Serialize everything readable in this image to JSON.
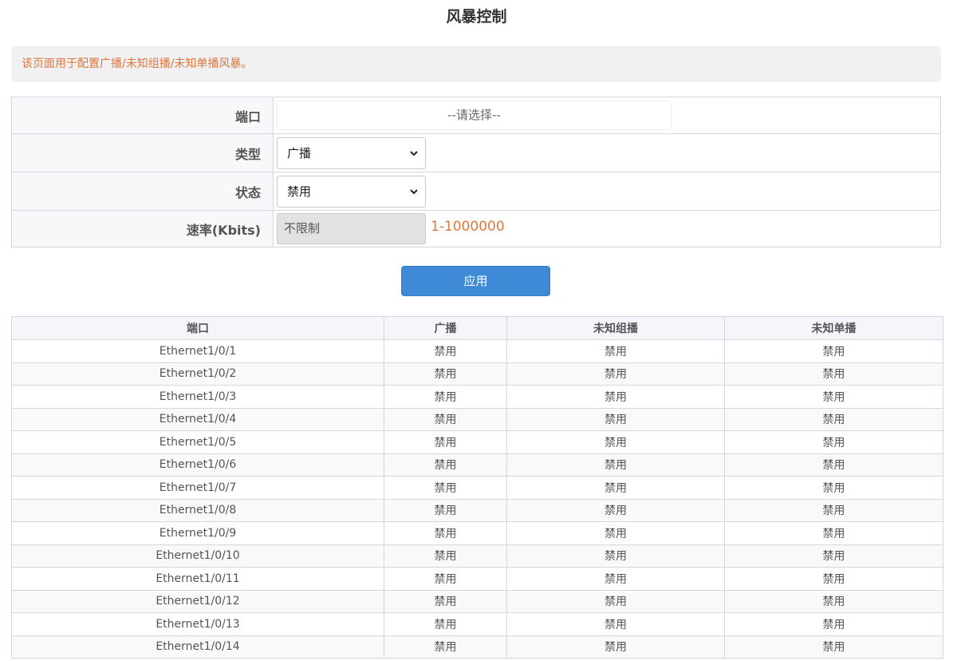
{
  "page": {
    "title": "风暴控制",
    "notice": "该页面用于配置广播/未知组播/未知单播风暴。"
  },
  "form": {
    "port_label": "端口",
    "port_placeholder": "--请选择--",
    "type_label": "类型",
    "type_value": "广播",
    "status_label": "状态",
    "status_value": "禁用",
    "rate_label": "速率(Kbits)",
    "rate_value": "不限制",
    "rate_range": "1-1000000",
    "apply_label": "应用"
  },
  "table": {
    "headers": {
      "port": "端口",
      "broadcast": "广播",
      "unknown_multicast": "未知组播",
      "unknown_unicast": "未知单播"
    },
    "rows": [
      {
        "port": "Ethernet1/0/1",
        "broadcast": "禁用",
        "unknown_multicast": "禁用",
        "unknown_unicast": "禁用"
      },
      {
        "port": "Ethernet1/0/2",
        "broadcast": "禁用",
        "unknown_multicast": "禁用",
        "unknown_unicast": "禁用"
      },
      {
        "port": "Ethernet1/0/3",
        "broadcast": "禁用",
        "unknown_multicast": "禁用",
        "unknown_unicast": "禁用"
      },
      {
        "port": "Ethernet1/0/4",
        "broadcast": "禁用",
        "unknown_multicast": "禁用",
        "unknown_unicast": "禁用"
      },
      {
        "port": "Ethernet1/0/5",
        "broadcast": "禁用",
        "unknown_multicast": "禁用",
        "unknown_unicast": "禁用"
      },
      {
        "port": "Ethernet1/0/6",
        "broadcast": "禁用",
        "unknown_multicast": "禁用",
        "unknown_unicast": "禁用"
      },
      {
        "port": "Ethernet1/0/7",
        "broadcast": "禁用",
        "unknown_multicast": "禁用",
        "unknown_unicast": "禁用"
      },
      {
        "port": "Ethernet1/0/8",
        "broadcast": "禁用",
        "unknown_multicast": "禁用",
        "unknown_unicast": "禁用"
      },
      {
        "port": "Ethernet1/0/9",
        "broadcast": "禁用",
        "unknown_multicast": "禁用",
        "unknown_unicast": "禁用"
      },
      {
        "port": "Ethernet1/0/10",
        "broadcast": "禁用",
        "unknown_multicast": "禁用",
        "unknown_unicast": "禁用"
      },
      {
        "port": "Ethernet1/0/11",
        "broadcast": "禁用",
        "unknown_multicast": "禁用",
        "unknown_unicast": "禁用"
      },
      {
        "port": "Ethernet1/0/12",
        "broadcast": "禁用",
        "unknown_multicast": "禁用",
        "unknown_unicast": "禁用"
      },
      {
        "port": "Ethernet1/0/13",
        "broadcast": "禁用",
        "unknown_multicast": "禁用",
        "unknown_unicast": "禁用"
      },
      {
        "port": "Ethernet1/0/14",
        "broadcast": "禁用",
        "unknown_multicast": "禁用",
        "unknown_unicast": "禁用"
      }
    ]
  },
  "colors": {
    "accent": "#3e8ad6",
    "hint": "#e0763a",
    "border": "#d3d7e0"
  },
  "icons": {
    "select_arrow": "chevron-down-icon"
  }
}
